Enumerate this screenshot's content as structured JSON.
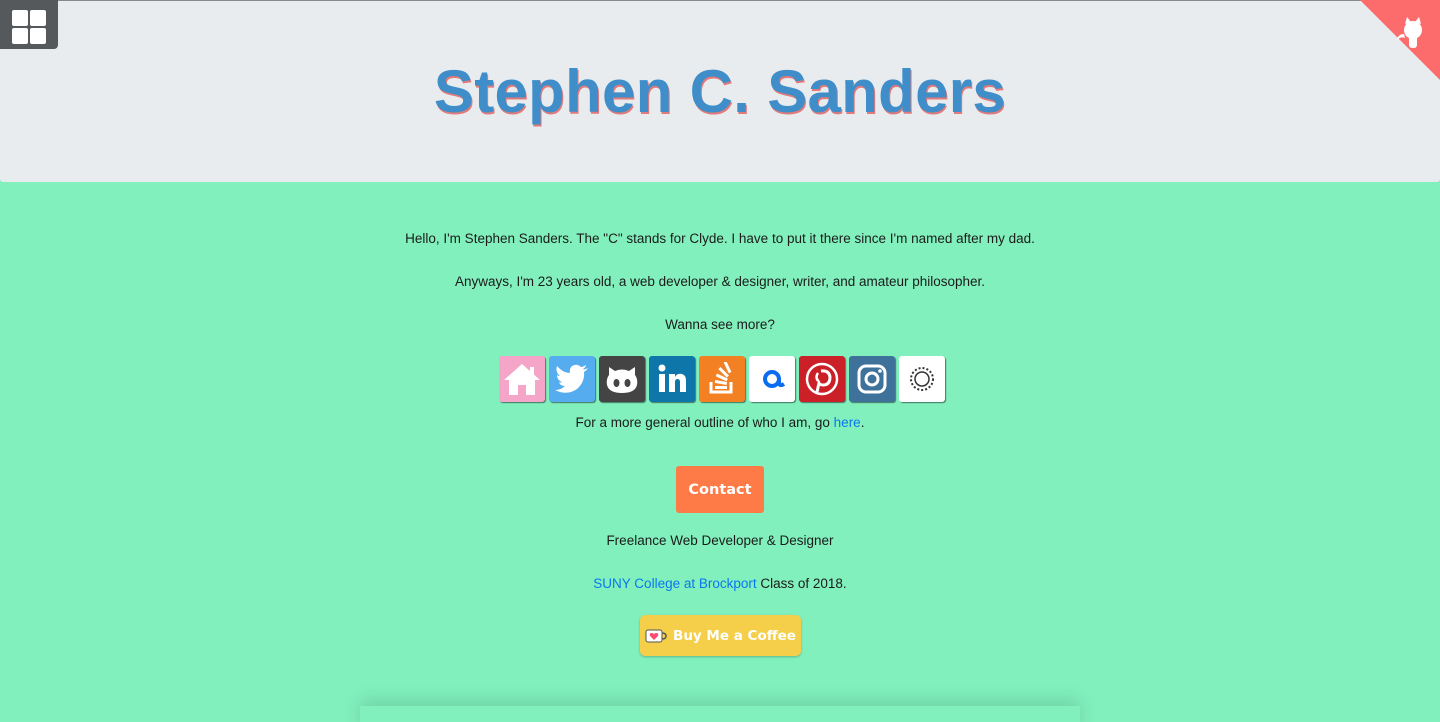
{
  "header": {
    "title": "Stephen C. Sanders"
  },
  "intro": {
    "p1": "Hello, I'm Stephen Sanders. The \"C\" stands for Clyde. I have to put it there since I'm named after my dad.",
    "p2": "Anyways, I'm 23 years old, a web developer & designer, writer, and amateur philosopher.",
    "p3": "Wanna see more?"
  },
  "social_icons": [
    "home-icon",
    "twitter-icon",
    "github-icon",
    "linkedin-icon",
    "stackoverflow-icon",
    "email-at-icon",
    "pinterest-icon",
    "instagram-icon",
    "vsco-icon"
  ],
  "outline": {
    "prefix": "For a more general outline of who I am, go ",
    "link": "here",
    "suffix": "."
  },
  "contact_label": "Contact",
  "role": "Freelance Web Developer & Designer",
  "education": {
    "link": "SUNY College at Brockport",
    "suffix": " Class of 2018."
  },
  "coffee_label": "Buy Me a Coffee",
  "colors": {
    "background": "#81f0bd",
    "header_bg": "#e8ecef",
    "title": "#3f8ec9",
    "contact": "#fe7a47",
    "coffee": "#f5cf4a",
    "link": "#0b76f0"
  }
}
